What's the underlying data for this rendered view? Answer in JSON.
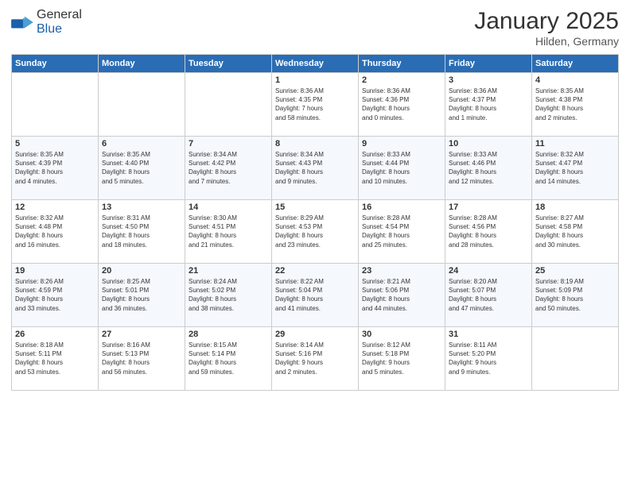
{
  "header": {
    "logo_general": "General",
    "logo_blue": "Blue",
    "title": "January 2025",
    "subtitle": "Hilden, Germany"
  },
  "weekdays": [
    "Sunday",
    "Monday",
    "Tuesday",
    "Wednesday",
    "Thursday",
    "Friday",
    "Saturday"
  ],
  "weeks": [
    [
      {
        "day": "",
        "info": ""
      },
      {
        "day": "",
        "info": ""
      },
      {
        "day": "",
        "info": ""
      },
      {
        "day": "1",
        "info": "Sunrise: 8:36 AM\nSunset: 4:35 PM\nDaylight: 7 hours\nand 58 minutes."
      },
      {
        "day": "2",
        "info": "Sunrise: 8:36 AM\nSunset: 4:36 PM\nDaylight: 8 hours\nand 0 minutes."
      },
      {
        "day": "3",
        "info": "Sunrise: 8:36 AM\nSunset: 4:37 PM\nDaylight: 8 hours\nand 1 minute."
      },
      {
        "day": "4",
        "info": "Sunrise: 8:35 AM\nSunset: 4:38 PM\nDaylight: 8 hours\nand 2 minutes."
      }
    ],
    [
      {
        "day": "5",
        "info": "Sunrise: 8:35 AM\nSunset: 4:39 PM\nDaylight: 8 hours\nand 4 minutes."
      },
      {
        "day": "6",
        "info": "Sunrise: 8:35 AM\nSunset: 4:40 PM\nDaylight: 8 hours\nand 5 minutes."
      },
      {
        "day": "7",
        "info": "Sunrise: 8:34 AM\nSunset: 4:42 PM\nDaylight: 8 hours\nand 7 minutes."
      },
      {
        "day": "8",
        "info": "Sunrise: 8:34 AM\nSunset: 4:43 PM\nDaylight: 8 hours\nand 9 minutes."
      },
      {
        "day": "9",
        "info": "Sunrise: 8:33 AM\nSunset: 4:44 PM\nDaylight: 8 hours\nand 10 minutes."
      },
      {
        "day": "10",
        "info": "Sunrise: 8:33 AM\nSunset: 4:46 PM\nDaylight: 8 hours\nand 12 minutes."
      },
      {
        "day": "11",
        "info": "Sunrise: 8:32 AM\nSunset: 4:47 PM\nDaylight: 8 hours\nand 14 minutes."
      }
    ],
    [
      {
        "day": "12",
        "info": "Sunrise: 8:32 AM\nSunset: 4:48 PM\nDaylight: 8 hours\nand 16 minutes."
      },
      {
        "day": "13",
        "info": "Sunrise: 8:31 AM\nSunset: 4:50 PM\nDaylight: 8 hours\nand 18 minutes."
      },
      {
        "day": "14",
        "info": "Sunrise: 8:30 AM\nSunset: 4:51 PM\nDaylight: 8 hours\nand 21 minutes."
      },
      {
        "day": "15",
        "info": "Sunrise: 8:29 AM\nSunset: 4:53 PM\nDaylight: 8 hours\nand 23 minutes."
      },
      {
        "day": "16",
        "info": "Sunrise: 8:28 AM\nSunset: 4:54 PM\nDaylight: 8 hours\nand 25 minutes."
      },
      {
        "day": "17",
        "info": "Sunrise: 8:28 AM\nSunset: 4:56 PM\nDaylight: 8 hours\nand 28 minutes."
      },
      {
        "day": "18",
        "info": "Sunrise: 8:27 AM\nSunset: 4:58 PM\nDaylight: 8 hours\nand 30 minutes."
      }
    ],
    [
      {
        "day": "19",
        "info": "Sunrise: 8:26 AM\nSunset: 4:59 PM\nDaylight: 8 hours\nand 33 minutes."
      },
      {
        "day": "20",
        "info": "Sunrise: 8:25 AM\nSunset: 5:01 PM\nDaylight: 8 hours\nand 36 minutes."
      },
      {
        "day": "21",
        "info": "Sunrise: 8:24 AM\nSunset: 5:02 PM\nDaylight: 8 hours\nand 38 minutes."
      },
      {
        "day": "22",
        "info": "Sunrise: 8:22 AM\nSunset: 5:04 PM\nDaylight: 8 hours\nand 41 minutes."
      },
      {
        "day": "23",
        "info": "Sunrise: 8:21 AM\nSunset: 5:06 PM\nDaylight: 8 hours\nand 44 minutes."
      },
      {
        "day": "24",
        "info": "Sunrise: 8:20 AM\nSunset: 5:07 PM\nDaylight: 8 hours\nand 47 minutes."
      },
      {
        "day": "25",
        "info": "Sunrise: 8:19 AM\nSunset: 5:09 PM\nDaylight: 8 hours\nand 50 minutes."
      }
    ],
    [
      {
        "day": "26",
        "info": "Sunrise: 8:18 AM\nSunset: 5:11 PM\nDaylight: 8 hours\nand 53 minutes."
      },
      {
        "day": "27",
        "info": "Sunrise: 8:16 AM\nSunset: 5:13 PM\nDaylight: 8 hours\nand 56 minutes."
      },
      {
        "day": "28",
        "info": "Sunrise: 8:15 AM\nSunset: 5:14 PM\nDaylight: 8 hours\nand 59 minutes."
      },
      {
        "day": "29",
        "info": "Sunrise: 8:14 AM\nSunset: 5:16 PM\nDaylight: 9 hours\nand 2 minutes."
      },
      {
        "day": "30",
        "info": "Sunrise: 8:12 AM\nSunset: 5:18 PM\nDaylight: 9 hours\nand 5 minutes."
      },
      {
        "day": "31",
        "info": "Sunrise: 8:11 AM\nSunset: 5:20 PM\nDaylight: 9 hours\nand 9 minutes."
      },
      {
        "day": "",
        "info": ""
      }
    ]
  ]
}
